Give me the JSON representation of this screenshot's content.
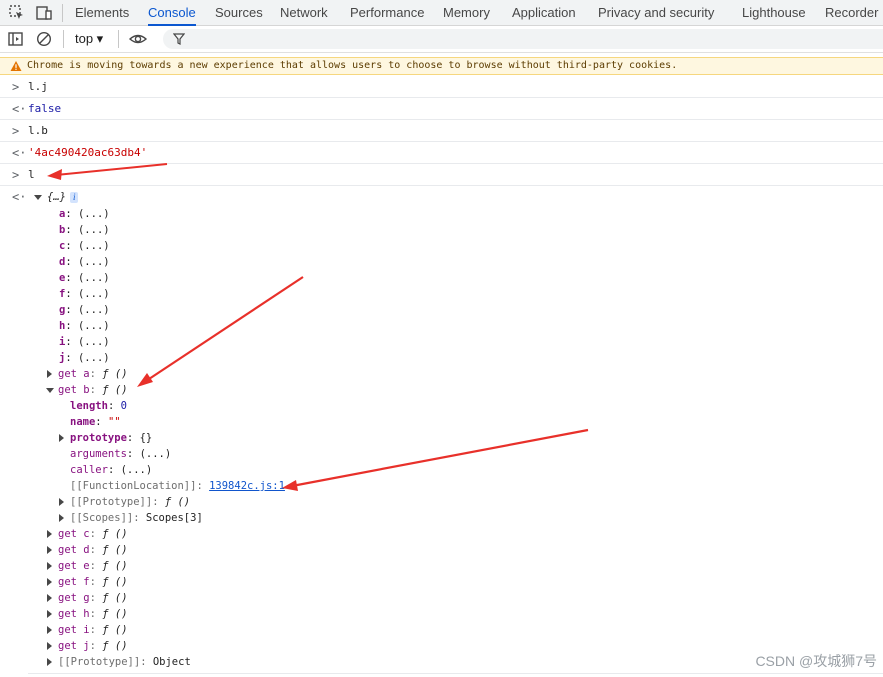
{
  "tabs": [
    {
      "label": "Elements",
      "active": false
    },
    {
      "label": "Console",
      "active": true
    },
    {
      "label": "Sources",
      "active": false
    },
    {
      "label": "Network",
      "active": false
    },
    {
      "label": "Performance",
      "active": false
    },
    {
      "label": "Memory",
      "active": false
    },
    {
      "label": "Application",
      "active": false
    },
    {
      "label": "Privacy and security",
      "active": false
    },
    {
      "label": "Lighthouse",
      "active": false
    },
    {
      "label": "Recorder",
      "active": false
    }
  ],
  "toolbar": {
    "context": "top ▾",
    "filter_icon": "filter-icon"
  },
  "warning": "Chrome is moving towards a new experience that allows users to choose to browse without third-party cookies.",
  "console": [
    {
      "prefix": ">",
      "text": "l.j",
      "kind": "input"
    },
    {
      "prefix": "<·",
      "text": "false",
      "kind": "result"
    },
    {
      "prefix": ">",
      "text": "l.b",
      "kind": "input"
    },
    {
      "prefix": "<·",
      "text": "'4ac490420ac63db4'",
      "kind": "result"
    },
    {
      "prefix": ">",
      "text": "l",
      "kind": "input"
    }
  ],
  "object": {
    "prefix": "<·",
    "summary": "{…}",
    "badge": "i",
    "props": [
      {
        "k": "a",
        "v": "(...)"
      },
      {
        "k": "b",
        "v": "(...)"
      },
      {
        "k": "c",
        "v": "(...)"
      },
      {
        "k": "d",
        "v": "(...)"
      },
      {
        "k": "e",
        "v": "(...)"
      },
      {
        "k": "f",
        "v": "(...)"
      },
      {
        "k": "g",
        "v": "(...)"
      },
      {
        "k": "h",
        "v": "(...)"
      },
      {
        "k": "i",
        "v": "(...)"
      },
      {
        "k": "j",
        "v": "(...)"
      }
    ],
    "getter_a": {
      "k": "get a",
      "v": "ƒ ()"
    },
    "getter_b": {
      "k": "get b",
      "v": "ƒ ()",
      "length_k": "length",
      "length_v": "0",
      "name_k": "name",
      "name_v": "\"\"",
      "prototype_k": "prototype",
      "prototype_v": "{}",
      "arguments_k": "arguments",
      "arguments_v": "(...)",
      "caller_k": "caller",
      "caller_v": "(...)",
      "location_k": "[[FunctionLocation]]",
      "location_v": "139842c.js:1",
      "proto_k": "[[Prototype]]",
      "proto_v": "ƒ ()",
      "scopes_k": "[[Scopes]]",
      "scopes_v": "Scopes[3]"
    },
    "getters": [
      {
        "k": "get c",
        "v": "ƒ ()"
      },
      {
        "k": "get d",
        "v": "ƒ ()"
      },
      {
        "k": "get e",
        "v": "ƒ ()"
      },
      {
        "k": "get f",
        "v": "ƒ ()"
      },
      {
        "k": "get g",
        "v": "ƒ ()"
      },
      {
        "k": "get h",
        "v": "ƒ ()"
      },
      {
        "k": "get i",
        "v": "ƒ ()"
      },
      {
        "k": "get j",
        "v": "ƒ ()"
      }
    ],
    "proto_k": "[[Prototype]]",
    "proto_v": "Object"
  },
  "watermark": "CSDN @攻城狮7号",
  "colors": {
    "accent": "#0b57d0",
    "arrow": "#e8302a",
    "warning_bg": "#fef7e0"
  }
}
